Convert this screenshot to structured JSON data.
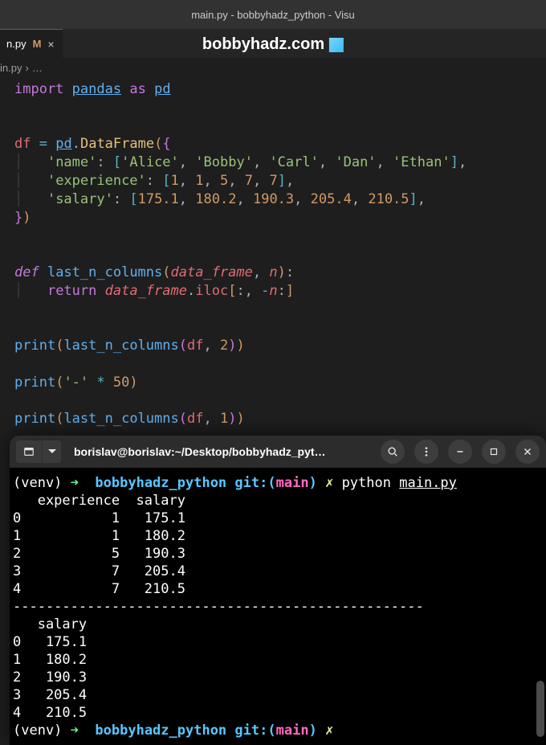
{
  "window": {
    "title": "main.py - bobbyhadz_python - Visu"
  },
  "watermark": {
    "text": "bobbyhadz.com"
  },
  "tab": {
    "label": "n.py",
    "modified_indicator": "M",
    "close": "×"
  },
  "breadcrumb": {
    "file": "in.py",
    "sep": "›",
    "more": "…"
  },
  "code": {
    "import_kw": "import",
    "pandas": "pandas",
    "as_kw": "as",
    "pd": "pd",
    "df": "df",
    "eq": "=",
    "dataframe": "DataFrame",
    "key_name": "'name'",
    "names": [
      "'Alice'",
      "'Bobby'",
      "'Carl'",
      "'Dan'",
      "'Ethan'"
    ],
    "key_exp": "'experience'",
    "exps": [
      "1",
      "1",
      "5",
      "7",
      "7"
    ],
    "key_sal": "'salary'",
    "sals": [
      "175.1",
      "180.2",
      "190.3",
      "205.4",
      "210.5"
    ],
    "def_kw": "def",
    "fn_name": "last_n_columns",
    "param1": "data_frame",
    "param2": "n",
    "return_kw": "return",
    "iloc": "iloc",
    "print": "print",
    "dash": "'-'",
    "star": "*",
    "fifty": "50",
    "two": "2",
    "one": "1"
  },
  "terminal": {
    "title": "borislav@borislav:~/Desktop/bobbyhadz_pyt…",
    "venv": "(venv)",
    "arrow": "➜",
    "dir": "bobbyhadz_python",
    "git_label": "git:(",
    "branch": "main",
    "git_close": ")",
    "x": "✗",
    "cmd": "python",
    "file": "main.py",
    "out1_header": "   experience  salary",
    "out1_rows": [
      "0           1   175.1",
      "1           1   180.2",
      "2           5   190.3",
      "3           7   205.4",
      "4           7   210.5"
    ],
    "sep": "--------------------------------------------------",
    "out2_header": "   salary",
    "out2_rows": [
      "0   175.1",
      "1   180.2",
      "2   190.3",
      "3   205.4",
      "4   210.5"
    ]
  }
}
